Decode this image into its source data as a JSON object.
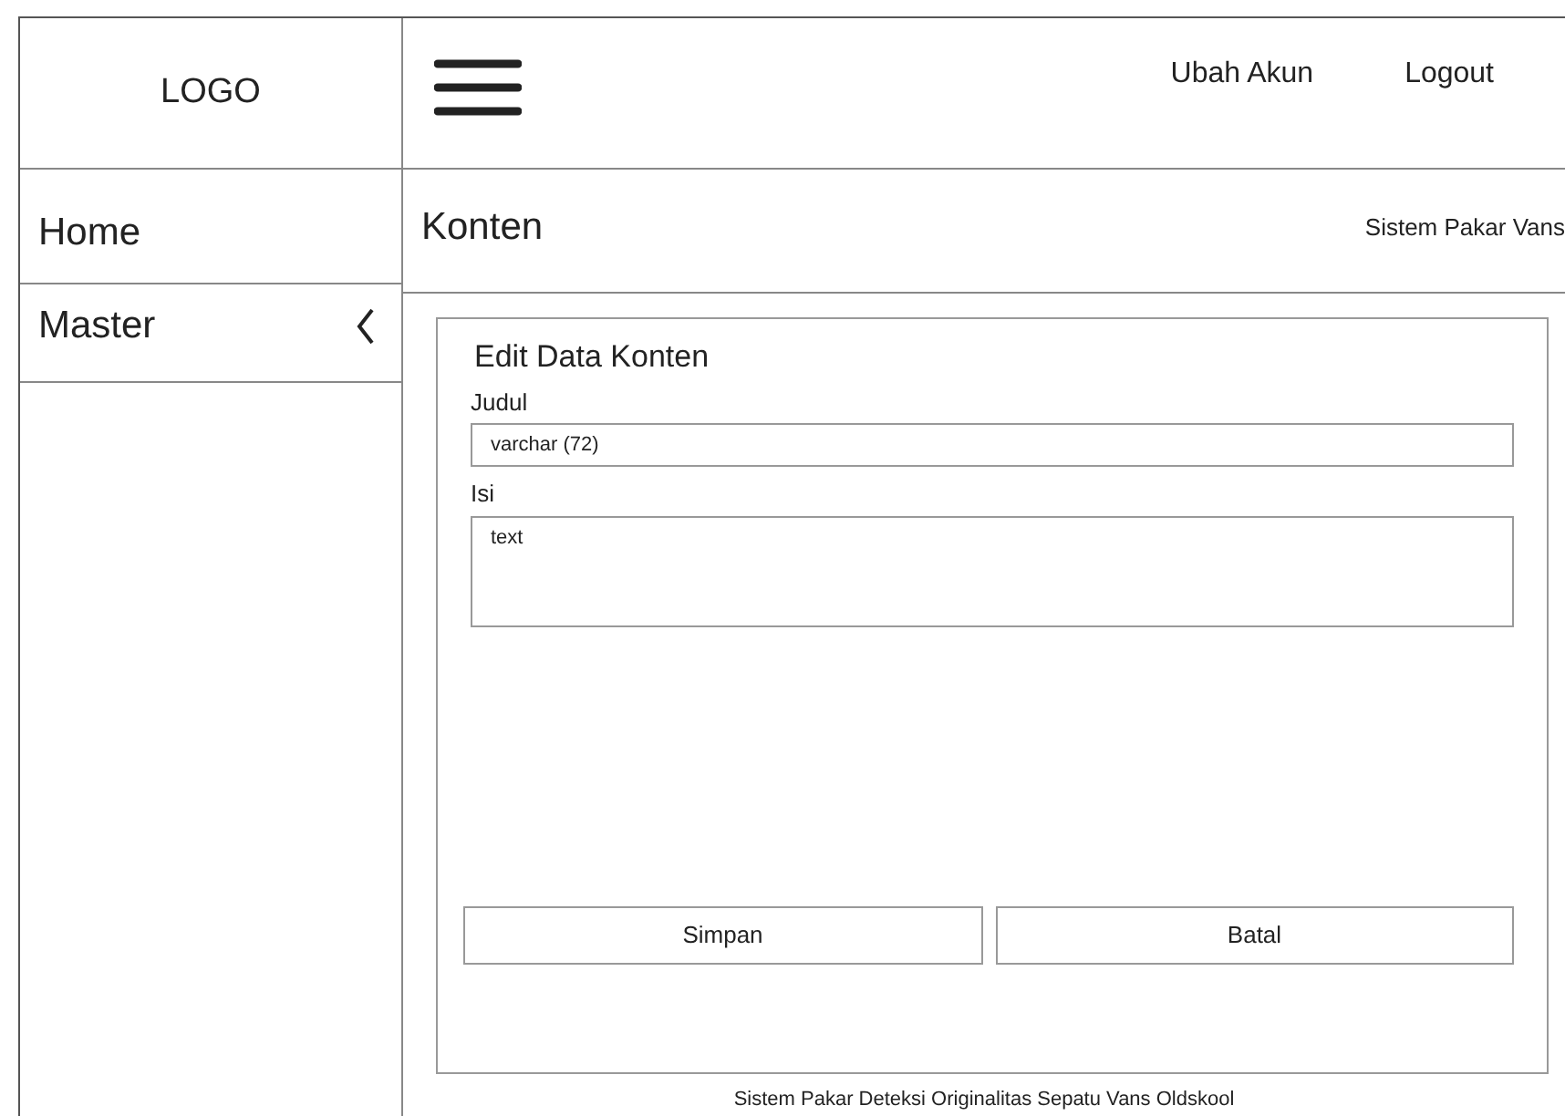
{
  "header": {
    "logo": "LOGO",
    "actions": [
      "Ubah Akun",
      "Logout"
    ]
  },
  "sidebar": {
    "items": [
      {
        "label": "Home",
        "has_submenu": false
      },
      {
        "label": "Master",
        "has_submenu": true
      }
    ]
  },
  "page": {
    "title": "Konten",
    "breadcrumb": "Sistem Pakar Vans"
  },
  "form": {
    "title": "Edit Data Konten",
    "fields": [
      {
        "label": "Judul",
        "kind": "input",
        "value": "varchar (72)"
      },
      {
        "label": "Isi",
        "kind": "textarea",
        "value": "text"
      }
    ],
    "buttons": [
      "Simpan",
      "Batal"
    ]
  },
  "footer": "Sistem Pakar Deteksi Originalitas Sepatu Vans Oldskool"
}
